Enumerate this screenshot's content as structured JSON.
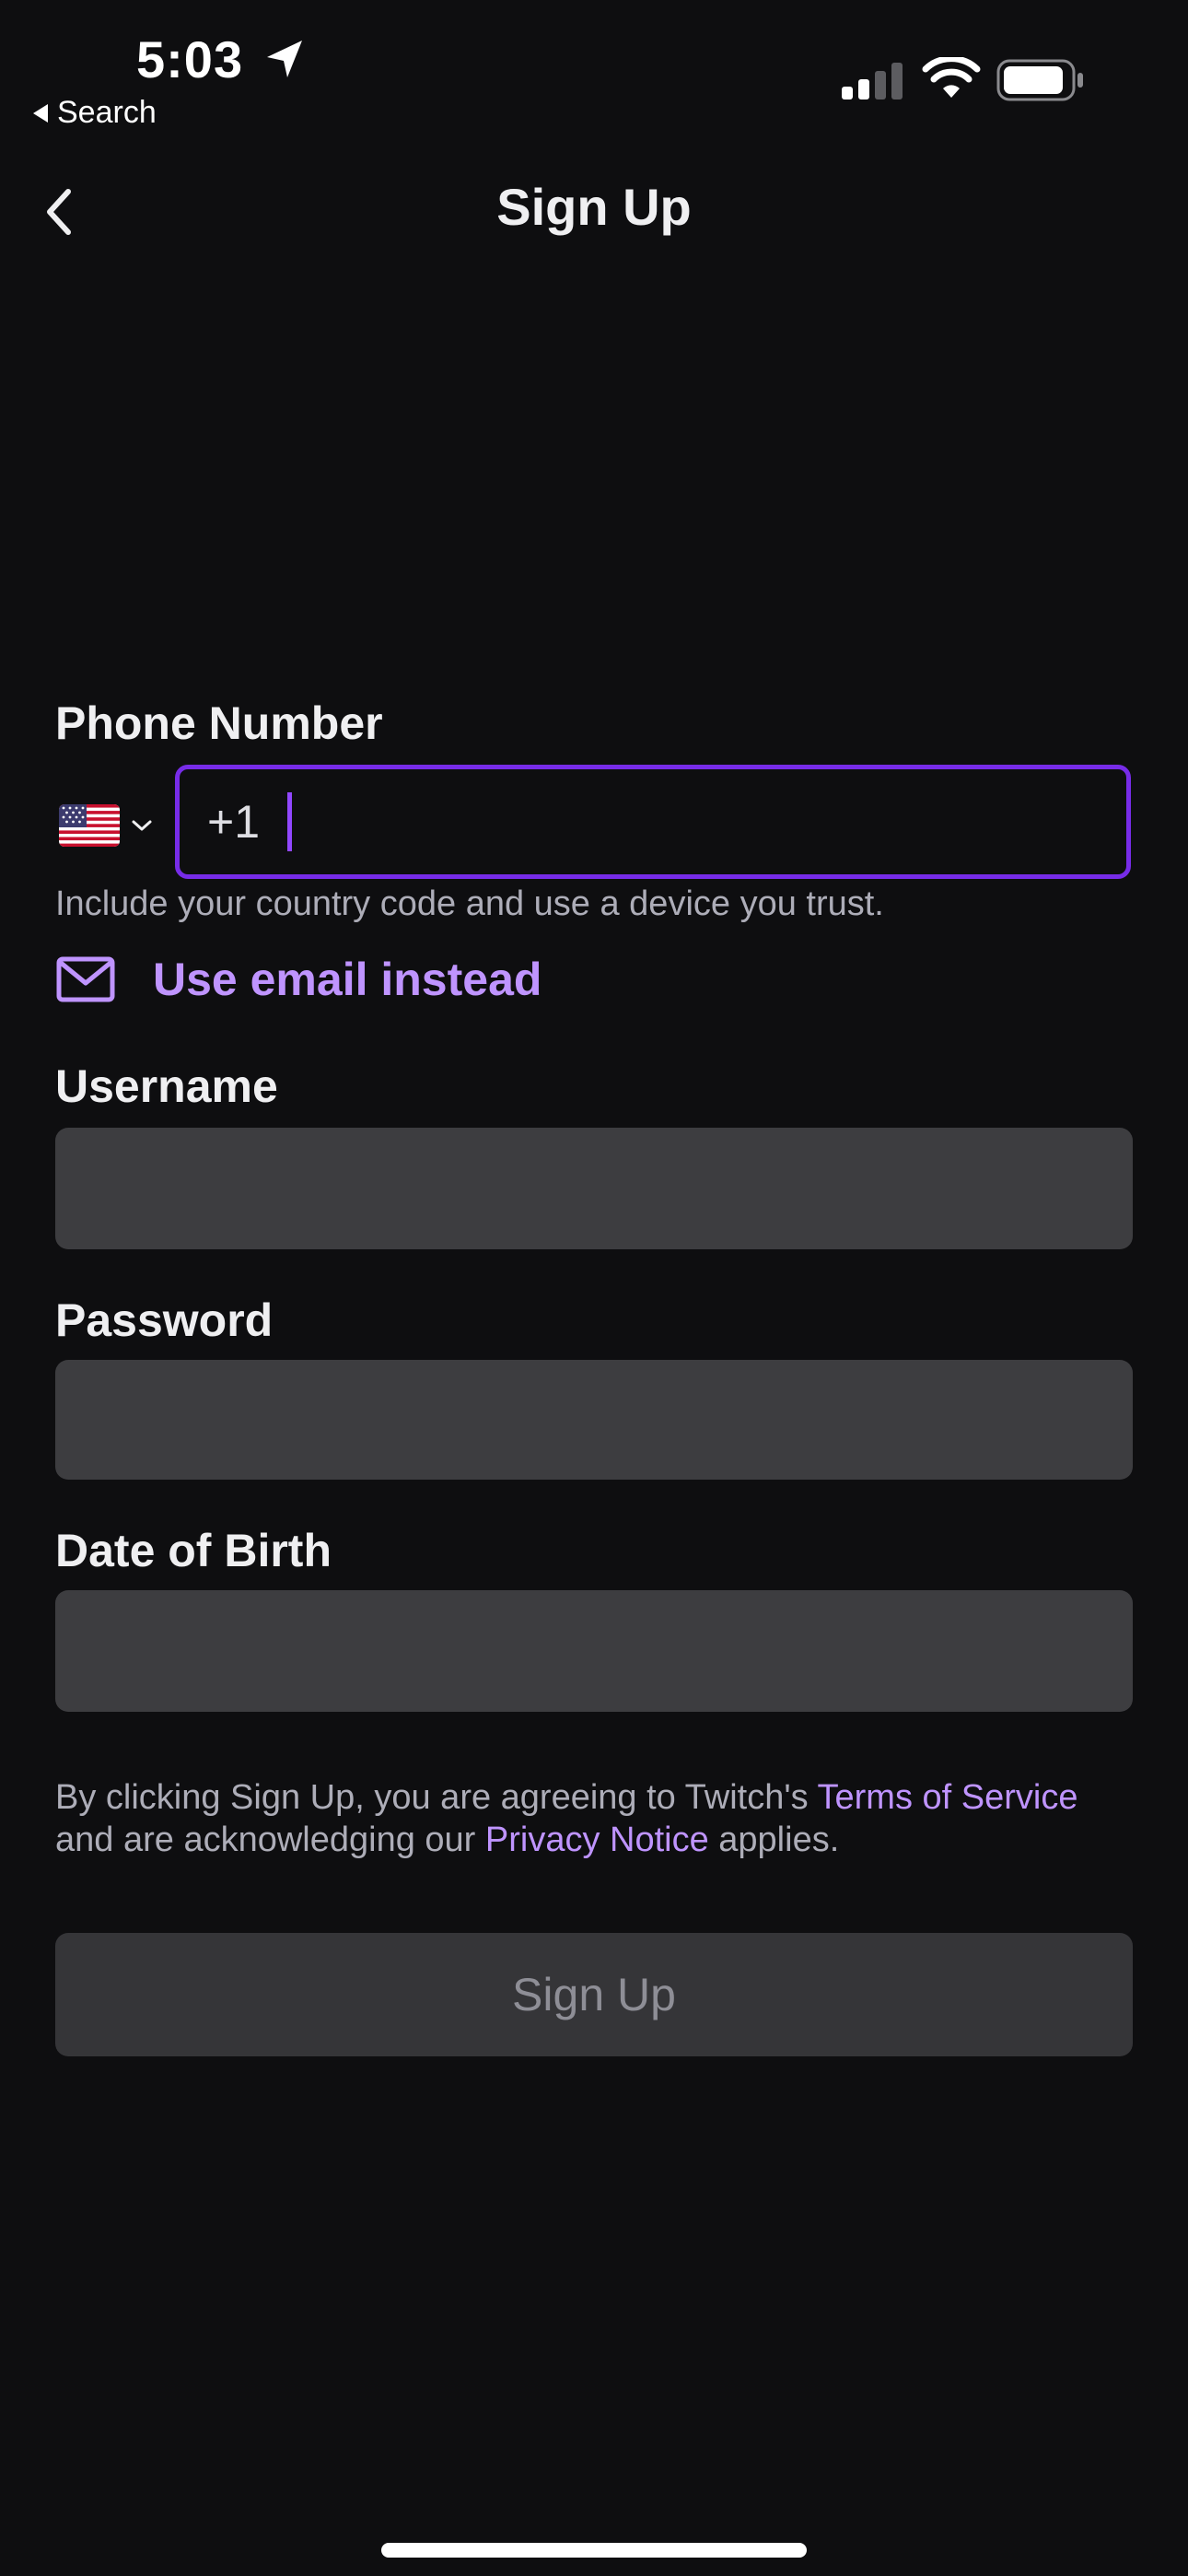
{
  "status_bar": {
    "time": "5:03",
    "back_app_label": "Search",
    "icons": [
      "location-arrow-icon",
      "cellular-signal-icon",
      "wifi-icon",
      "battery-icon"
    ]
  },
  "header": {
    "title": "Sign Up",
    "back_icon": "chevron-left-icon"
  },
  "form": {
    "phone": {
      "label": "Phone Number",
      "country_flag": "US",
      "dial_code": "+1",
      "value": "",
      "hint": "Include your country code and use a device you trust."
    },
    "email_toggle": {
      "icon": "mail-icon",
      "label": "Use email instead"
    },
    "username": {
      "label": "Username",
      "value": ""
    },
    "password": {
      "label": "Password",
      "value": ""
    },
    "dob": {
      "label": "Date of Birth",
      "value": ""
    }
  },
  "legal": {
    "prefix": "By clicking Sign Up, you are agreeing to Twitch's ",
    "terms_link": "Terms of Service",
    "middle": " and are acknowledging our ",
    "privacy_link": "Privacy Notice",
    "suffix": " applies."
  },
  "submit": {
    "label": "Sign Up"
  },
  "colors": {
    "background": "#0e0e10",
    "accent": "#9147ff",
    "link": "#bf94ff",
    "input_fill": "#3d3d40",
    "button_disabled": "#353538"
  }
}
